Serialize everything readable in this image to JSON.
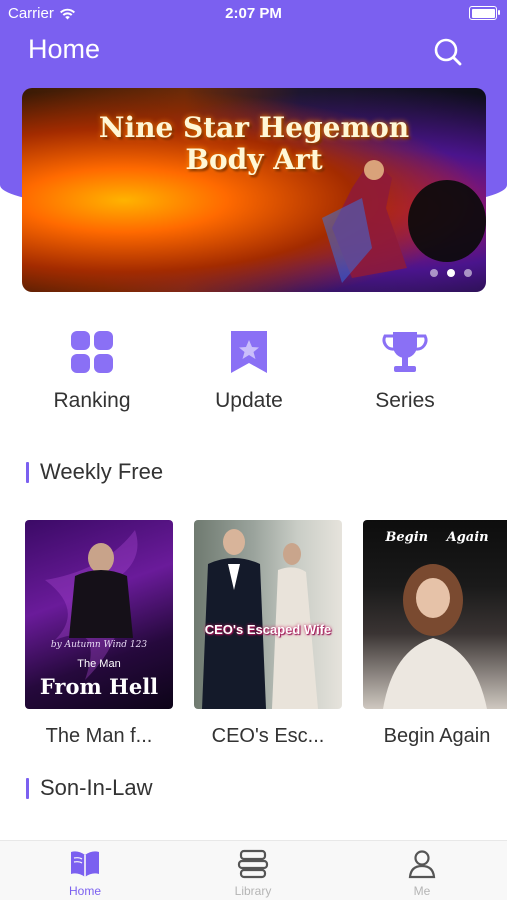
{
  "status_bar": {
    "carrier": "Carrier",
    "time": "2:07 PM"
  },
  "header": {
    "title": "Home",
    "search_icon": "search-icon"
  },
  "banner": {
    "title_line1": "Nine Star Hegemon",
    "title_line2": "Body Art",
    "dots": 3,
    "active_dot": 2
  },
  "entries": [
    {
      "label": "Ranking",
      "icon": "grid-icon"
    },
    {
      "label": "Update",
      "icon": "bookmark-star-icon"
    },
    {
      "label": "Series",
      "icon": "trophy-icon"
    }
  ],
  "sections": {
    "weekly_free": {
      "title": "Weekly Free",
      "books": [
        {
          "name": "The Man f...",
          "cover_author": "by Autumn Wind 123",
          "cover_small": "The Man",
          "cover_big": "From Hell"
        },
        {
          "name": "CEO's Esc...",
          "cover_title": "CEO's Escaped Wife"
        },
        {
          "name": "Begin Again",
          "cover_title": "Begin Again"
        }
      ]
    },
    "son_in_law": {
      "title": "Son-In-Law"
    }
  },
  "tabbar": {
    "items": [
      {
        "label": "Home",
        "icon": "book-open-icon",
        "active": true
      },
      {
        "label": "Library",
        "icon": "library-icon",
        "active": false
      },
      {
        "label": "Me",
        "icon": "person-icon",
        "active": false
      }
    ]
  },
  "colors": {
    "accent": "#7b60f0",
    "icon_light": "#8a70f5",
    "inactive": "#b5b5b5",
    "text": "#333333"
  }
}
